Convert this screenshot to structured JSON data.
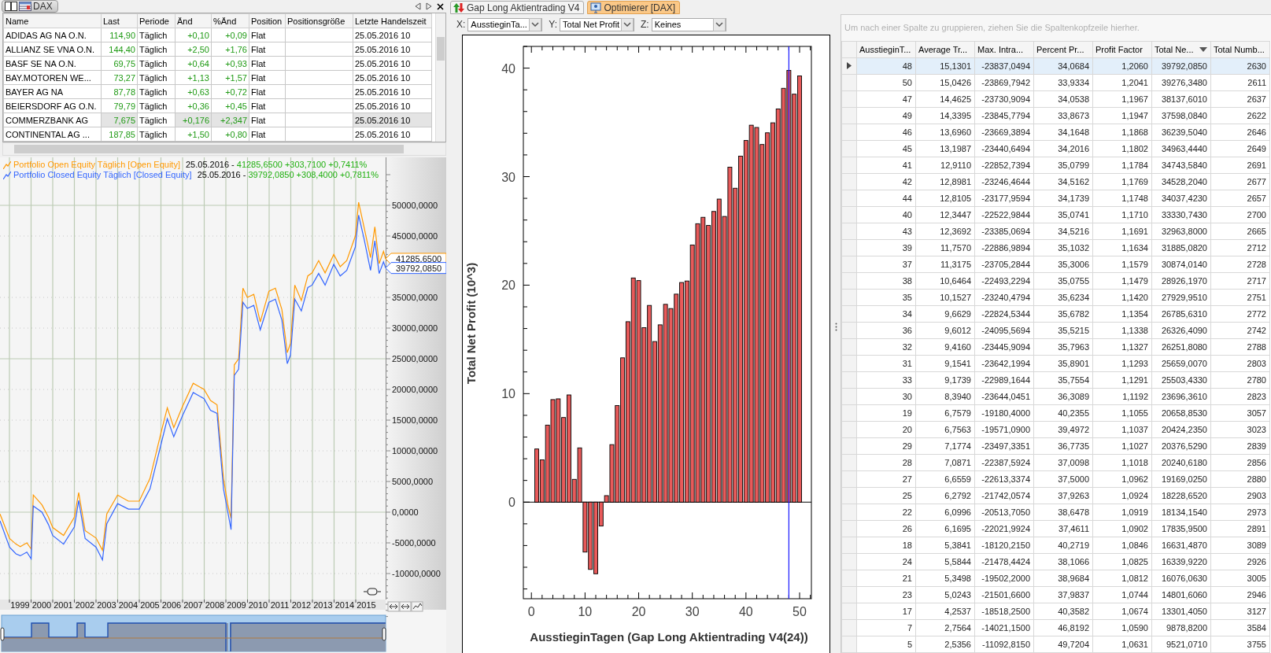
{
  "watchlist": {
    "tab": {
      "label": "DAX"
    },
    "columns": [
      "Name",
      "Last",
      "Periode",
      "Änd",
      "%Änd",
      "Position",
      "Positionsgröße",
      "Letzte Handelszeit"
    ],
    "rows": [
      {
        "name": "ADIDAS AG NA O.N.",
        "last": "114,90",
        "period": "Täglich",
        "change": "+0,10",
        "change_pct": "+0,09",
        "position": "Flat",
        "last_trade": "25.05.2016 10",
        "highlighted": false
      },
      {
        "name": "ALLIANZ SE VNA O.N.",
        "last": "144,40",
        "period": "Täglich",
        "change": "+2,50",
        "change_pct": "+1,76",
        "position": "Flat",
        "last_trade": "25.05.2016 10",
        "highlighted": false
      },
      {
        "name": "BASF SE NA O.N.",
        "last": "69,75",
        "period": "Täglich",
        "change": "+0,64",
        "change_pct": "+0,93",
        "position": "Flat",
        "last_trade": "25.05.2016 10",
        "highlighted": false
      },
      {
        "name": "BAY.MOTOREN WE...",
        "last": "73,27",
        "period": "Täglich",
        "change": "+1,13",
        "change_pct": "+1,57",
        "position": "Flat",
        "last_trade": "25.05.2016 10",
        "highlighted": false
      },
      {
        "name": "BAYER AG  NA",
        "last": "87,78",
        "period": "Täglich",
        "change": "+0,63",
        "change_pct": "+0,72",
        "position": "Flat",
        "last_trade": "25.05.2016 10",
        "highlighted": false
      },
      {
        "name": "BEIERSDORF AG O.N.",
        "last": "79,79",
        "period": "Täglich",
        "change": "+0,36",
        "change_pct": "+0,45",
        "position": "Flat",
        "last_trade": "25.05.2016 10",
        "highlighted": false
      },
      {
        "name": "COMMERZBANK AG",
        "last": "7,675",
        "period": "Täglich",
        "change": "+0,176",
        "change_pct": "+2,347",
        "position": "Flat",
        "last_trade": "25.05.2016 10",
        "highlighted": true
      },
      {
        "name": "CONTINENTAL AG ...",
        "last": "187,85",
        "period": "Täglich",
        "change": "+1,50",
        "change_pct": "+0,80",
        "position": "Flat",
        "last_trade": "25.05.2016 10",
        "highlighted": false
      }
    ]
  },
  "equity_chart": {
    "legend": [
      {
        "label": "Portfolio Open Equity Täglich [Open Equity]",
        "color": "#ff9900",
        "date": "25.05.2016 -",
        "values": "41285,6500 +303,7100 +0,7411%"
      },
      {
        "label": "Portfolio Closed Equity Täglich [Closed Equity]",
        "color": "#3366ff",
        "date": "25.05.2016 -",
        "values": "39792,0850 +308,4000 +0,7811%"
      }
    ],
    "price_tags": [
      "41285,6500",
      "39792,0850"
    ],
    "y_labels": [
      "50000,0000",
      "45000,0000",
      "35000,0000",
      "30000,0000",
      "25000,0000",
      "20000,0000",
      "15000,0000",
      "10000,0000",
      "5000,0000",
      "0,0000",
      "-5000,0000",
      "-10000,0000"
    ],
    "x_labels": [
      "1999",
      "2000",
      "2001",
      "2002",
      "2003",
      "2004",
      "2005",
      "2006",
      "2007",
      "2008",
      "2009",
      "2010",
      "2011",
      "2012",
      "2013",
      "2014",
      "2015"
    ]
  },
  "optimizer": {
    "tabs": [
      {
        "label": "Gap Long Aktientrading V4",
        "selected": false
      },
      {
        "label": "Optimierer [DAX]",
        "selected": true
      }
    ],
    "axis_selectors": [
      {
        "label": "X:",
        "value": "AusstieginTa..."
      },
      {
        "label": "Y:",
        "value": "Total Net Profit"
      },
      {
        "label": "Z:",
        "value": "Keines"
      }
    ],
    "chart_data": {
      "type": "bar",
      "xlabel": "AusstieginTagen (Gap Long Aktientrading V4(24))",
      "ylabel": "Total Net Profit (10^3)",
      "x": [
        1,
        2,
        3,
        4,
        5,
        6,
        7,
        8,
        9,
        10,
        11,
        12,
        13,
        14,
        15,
        16,
        17,
        18,
        19,
        20,
        21,
        22,
        23,
        24,
        25,
        26,
        27,
        28,
        29,
        30,
        31,
        32,
        33,
        34,
        35,
        36,
        37,
        38,
        39,
        40,
        41,
        42,
        43,
        44,
        45,
        46,
        47,
        48,
        49,
        50
      ],
      "series": [
        {
          "color": "#e85a5a",
          "values": [
            4.9,
            3.9,
            7.1,
            9.45,
            9.52,
            7.8,
            9.88,
            2.1,
            5.0,
            -4.6,
            -6.2,
            -6.6,
            -2.2,
            0.6,
            5.3,
            8.9,
            13.3,
            16.63,
            20.66,
            20.42,
            16.08,
            18.13,
            14.8,
            16.34,
            18.23,
            17.84,
            19.17,
            20.24,
            20.38,
            23.7,
            25.66,
            26.25,
            25.5,
            26.79,
            27.93,
            26.33,
            30.87,
            28.93,
            31.89,
            33.33,
            34.74,
            34.53,
            32.96,
            34.04,
            34.96,
            36.24,
            38.14,
            39.79,
            37.6,
            39.28
          ]
        }
      ],
      "xlim": [
        -1.5,
        52.2
      ],
      "ylim": [
        -8.9,
        42.0
      ],
      "xticks": [
        0,
        10,
        20,
        30,
        40,
        50
      ],
      "yticks": [
        0,
        10,
        20,
        30,
        40
      ],
      "ref_lines": [
        {
          "axis": "x",
          "value": 48
        }
      ]
    }
  },
  "results_grid": {
    "group_hint": "Um nach einer Spalte zu gruppieren, ziehen Sie die Spaltenkopfzeile hierher.",
    "columns": [
      {
        "label": "AusstieginT...",
        "sorted": false
      },
      {
        "label": "Average Tr...",
        "sorted": false
      },
      {
        "label": "Max. Intra...",
        "sorted": false
      },
      {
        "label": "Percent Pr...",
        "sorted": false
      },
      {
        "label": "Profit Factor",
        "sorted": false
      },
      {
        "label": "Total Ne...",
        "sorted": true
      },
      {
        "label": "Total Numb...",
        "sorted": false
      }
    ],
    "rows": [
      {
        "selected": true,
        "cells": [
          "48",
          "15,1301",
          "-23837,0494",
          "34,0684",
          "1,2060",
          "39792,0850",
          "2630"
        ]
      },
      {
        "selected": false,
        "cells": [
          "50",
          "15,0426",
          "-23869,7942",
          "33,9334",
          "1,2041",
          "39276,3480",
          "2611"
        ]
      },
      {
        "selected": false,
        "cells": [
          "47",
          "14,4625",
          "-23730,9094",
          "34,0538",
          "1,1967",
          "38137,6010",
          "2637"
        ]
      },
      {
        "selected": false,
        "cells": [
          "49",
          "14,3395",
          "-23845,7794",
          "33,8673",
          "1,1947",
          "37598,0840",
          "2622"
        ]
      },
      {
        "selected": false,
        "cells": [
          "46",
          "13,6960",
          "-23669,3894",
          "34,1648",
          "1,1868",
          "36239,5040",
          "2646"
        ]
      },
      {
        "selected": false,
        "cells": [
          "45",
          "13,1987",
          "-23440,6494",
          "34,2016",
          "1,1802",
          "34963,4440",
          "2649"
        ]
      },
      {
        "selected": false,
        "cells": [
          "41",
          "12,9110",
          "-22852,7394",
          "35,0799",
          "1,1784",
          "34743,5840",
          "2691"
        ]
      },
      {
        "selected": false,
        "cells": [
          "42",
          "12,8981",
          "-23246,4644",
          "34,5162",
          "1,1769",
          "34528,2040",
          "2677"
        ]
      },
      {
        "selected": false,
        "cells": [
          "44",
          "12,8105",
          "-23177,9594",
          "34,1739",
          "1,1748",
          "34037,4230",
          "2657"
        ]
      },
      {
        "selected": false,
        "cells": [
          "40",
          "12,3447",
          "-22522,9844",
          "35,0741",
          "1,1710",
          "33330,7430",
          "2700"
        ]
      },
      {
        "selected": false,
        "cells": [
          "43",
          "12,3692",
          "-23385,0694",
          "34,5216",
          "1,1691",
          "32963,8000",
          "2665"
        ]
      },
      {
        "selected": false,
        "cells": [
          "39",
          "11,7570",
          "-22886,9894",
          "35,1032",
          "1,1634",
          "31885,0820",
          "2712"
        ]
      },
      {
        "selected": false,
        "cells": [
          "37",
          "11,3175",
          "-23705,2844",
          "35,3006",
          "1,1579",
          "30874,0140",
          "2728"
        ]
      },
      {
        "selected": false,
        "cells": [
          "38",
          "10,6464",
          "-22493,2294",
          "35,0755",
          "1,1479",
          "28926,1970",
          "2717"
        ]
      },
      {
        "selected": false,
        "cells": [
          "35",
          "10,1527",
          "-23240,4794",
          "35,6234",
          "1,1420",
          "27929,9510",
          "2751"
        ]
      },
      {
        "selected": false,
        "cells": [
          "34",
          "9,6629",
          "-22824,5344",
          "35,6782",
          "1,1354",
          "26785,6310",
          "2772"
        ]
      },
      {
        "selected": false,
        "cells": [
          "36",
          "9,6012",
          "-24095,5694",
          "35,5215",
          "1,1338",
          "26326,4090",
          "2742"
        ]
      },
      {
        "selected": false,
        "cells": [
          "32",
          "9,4160",
          "-23445,9094",
          "35,7963",
          "1,1327",
          "26251,8080",
          "2788"
        ]
      },
      {
        "selected": false,
        "cells": [
          "31",
          "9,1541",
          "-23642,1994",
          "35,8901",
          "1,1293",
          "25659,0070",
          "2803"
        ]
      },
      {
        "selected": false,
        "cells": [
          "33",
          "9,1739",
          "-22989,1644",
          "35,7554",
          "1,1291",
          "25503,4330",
          "2780"
        ]
      },
      {
        "selected": false,
        "cells": [
          "30",
          "8,3940",
          "-23644,0451",
          "36,3089",
          "1,1192",
          "23696,3610",
          "2823"
        ]
      },
      {
        "selected": false,
        "cells": [
          "19",
          "6,7579",
          "-19180,4000",
          "40,2355",
          "1,1055",
          "20658,8530",
          "3057"
        ]
      },
      {
        "selected": false,
        "cells": [
          "20",
          "6,7563",
          "-19571,0900",
          "39,4972",
          "1,1037",
          "20424,2350",
          "3023"
        ]
      },
      {
        "selected": false,
        "cells": [
          "29",
          "7,1774",
          "-23497,3351",
          "36,7735",
          "1,1027",
          "20376,5290",
          "2839"
        ]
      },
      {
        "selected": false,
        "cells": [
          "28",
          "7,0871",
          "-22387,5924",
          "37,0098",
          "1,1018",
          "20240,6180",
          "2856"
        ]
      },
      {
        "selected": false,
        "cells": [
          "27",
          "6,6559",
          "-22613,3374",
          "37,5000",
          "1,0962",
          "19169,0250",
          "2880"
        ]
      },
      {
        "selected": false,
        "cells": [
          "25",
          "6,2792",
          "-21742,0574",
          "37,9263",
          "1,0924",
          "18228,6520",
          "2903"
        ]
      },
      {
        "selected": false,
        "cells": [
          "22",
          "6,0996",
          "-20513,7050",
          "38,6478",
          "1,0919",
          "18134,1540",
          "2973"
        ]
      },
      {
        "selected": false,
        "cells": [
          "26",
          "6,1695",
          "-22021,9924",
          "37,4611",
          "1,0902",
          "17835,9500",
          "2891"
        ]
      },
      {
        "selected": false,
        "cells": [
          "18",
          "5,3841",
          "-18120,2150",
          "40,2719",
          "1,0846",
          "16631,4870",
          "3089"
        ]
      },
      {
        "selected": false,
        "cells": [
          "24",
          "5,5844",
          "-21478,4424",
          "38,1066",
          "1,0825",
          "16339,9220",
          "2926"
        ]
      },
      {
        "selected": false,
        "cells": [
          "21",
          "5,3498",
          "-19502,2000",
          "38,9684",
          "1,0812",
          "16076,0630",
          "3005"
        ]
      },
      {
        "selected": false,
        "cells": [
          "23",
          "5,0243",
          "-21501,6600",
          "37,9837",
          "1,0744",
          "14801,6060",
          "2946"
        ]
      },
      {
        "selected": false,
        "cells": [
          "17",
          "4,2537",
          "-18518,2500",
          "40,3582",
          "1,0674",
          "13301,4050",
          "3127"
        ]
      },
      {
        "selected": false,
        "cells": [
          "7",
          "2,7564",
          "-14021,1500",
          "46,8192",
          "1,0590",
          "9878,8200",
          "3584"
        ]
      },
      {
        "selected": false,
        "cells": [
          "5",
          "2,5356",
          "-11092,8150",
          "49,7204",
          "1,0631",
          "9521,0710",
          "3755"
        ]
      }
    ]
  }
}
